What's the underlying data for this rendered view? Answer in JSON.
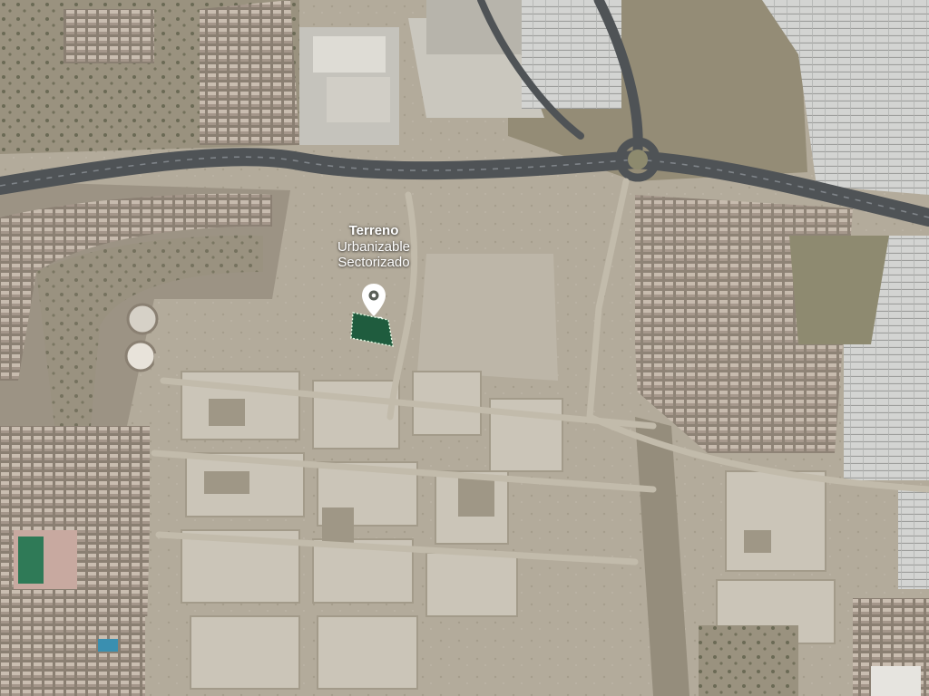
{
  "map": {
    "view": "satellite",
    "plot_label": {
      "title": "Terreno",
      "line1": "Urbanizable",
      "line2": "Sectorizado"
    },
    "marker": {
      "icon": "map-pin-icon",
      "color": "#ffffff"
    },
    "plot_area": {
      "fill": "#1f5c3e",
      "outline": "#e8ffe8"
    }
  }
}
